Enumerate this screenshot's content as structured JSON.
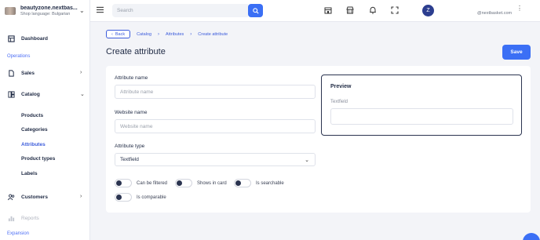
{
  "store": {
    "name": "beautyzone.nextbas...",
    "language": "Shop language: Bulgarian"
  },
  "sidebar": {
    "dashboard": "Dashboard",
    "section_operations": "Operations",
    "sales": "Sales",
    "catalog": "Catalog",
    "catalog_items": [
      "Products",
      "Categories",
      "Attributes",
      "Product types",
      "Labels"
    ],
    "customers": "Customers",
    "reports": "Reports",
    "section_expansion": "Expansion"
  },
  "topbar": {
    "search_placeholder": "Search",
    "avatar_letter": "Z",
    "user_email": "@nextbasket.com"
  },
  "breadcrumb": {
    "back": "Back",
    "items": [
      "Catalog",
      "Attributes",
      "Create attribute"
    ]
  },
  "page": {
    "title": "Create attribute",
    "save_label": "Save"
  },
  "form": {
    "attribute_name_label": "Attribute name",
    "attribute_name_placeholder": "Attribute name",
    "attribute_name_value": "",
    "website_name_label": "Website name",
    "website_name_placeholder": "Website name",
    "website_name_value": "",
    "attribute_type_label": "Attribute type",
    "attribute_type_value": "Textfield",
    "toggles": [
      {
        "label": "Can be filtered",
        "on": false
      },
      {
        "label": "Shows in card",
        "on": false
      },
      {
        "label": "Is searchable",
        "on": false
      },
      {
        "label": "Is comparable",
        "on": false
      }
    ]
  },
  "preview": {
    "title": "Preview",
    "field_label": "Textfield"
  },
  "colors": {
    "accent": "#3b6ff5",
    "active_nav": "#3b5bdb",
    "avatar": "#2c3e8f"
  }
}
